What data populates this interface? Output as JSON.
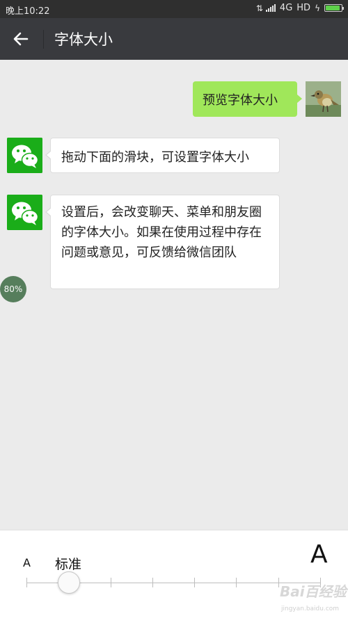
{
  "status_bar": {
    "time": "晚上10:22",
    "network": "4G",
    "quality": "HD",
    "icons": [
      "data-arrows-icon",
      "signal-icon",
      "charging-bolt-icon",
      "battery-icon"
    ],
    "battery_level": 0.9
  },
  "title_bar": {
    "back_icon": "arrow-left-icon",
    "title": "字体大小"
  },
  "chat": {
    "messages": [
      {
        "side": "right",
        "avatar": "bird-avatar",
        "text": "预览字体大小"
      },
      {
        "side": "left",
        "avatar": "wechat-logo",
        "text": "拖动下面的滑块，可设置字体大小"
      },
      {
        "side": "left",
        "avatar": "wechat-logo",
        "text": "设置后，会改变聊天、菜单和朋友圈的字体大小。如果在使用过程中存在问题或意见，可反馈给微信团队"
      }
    ],
    "zoom_badge": "80%"
  },
  "font_size_panel": {
    "small_label": "A",
    "large_label": "A",
    "current_label": "标准",
    "steps": 8,
    "selected_step": 1
  },
  "watermark": {
    "text": "Bai百经验",
    "sub": "jingyan.baidu.com"
  },
  "colors": {
    "title_bar": "#393a3e",
    "self_bubble": "#a0e75a",
    "wechat_green": "#1aad19",
    "background": "#ebebeb"
  }
}
